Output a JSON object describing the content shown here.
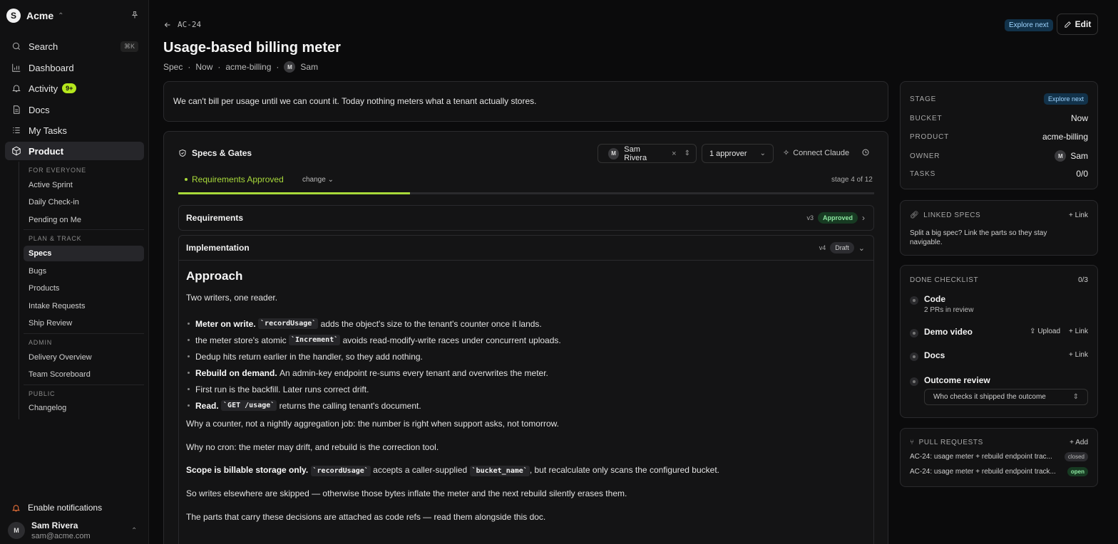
{
  "workspace": {
    "initial": "S",
    "name": "Acme"
  },
  "nav": {
    "search": "Search",
    "search_kbd": "⌘K",
    "dashboard": "Dashboard",
    "activity": "Activity",
    "activity_badge": "9+",
    "docs": "Docs",
    "my_tasks": "My Tasks",
    "product": "Product"
  },
  "sections": {
    "everyone": "FOR EVERYONE",
    "plan": "PLAN & TRACK",
    "admin": "ADMIN",
    "public": "PUBLIC"
  },
  "subnav": {
    "active_sprint": "Active Sprint",
    "daily_checkin": "Daily Check-in",
    "pending": "Pending on Me",
    "specs": "Specs",
    "bugs": "Bugs",
    "products": "Products",
    "intake": "Intake Requests",
    "ship_review": "Ship Review",
    "delivery": "Delivery Overview",
    "scoreboard": "Team Scoreboard",
    "changelog": "Changelog"
  },
  "footer": {
    "notifications": "Enable notifications",
    "user_initial": "M",
    "user_name": "Sam Rivera",
    "user_email": "sam@acme.com"
  },
  "header": {
    "breadcrumb": "AC-24",
    "status_badge": "Explore next",
    "edit": "Edit",
    "title": "Usage-based billing meter",
    "meta": {
      "type": "Spec",
      "sep": "·",
      "bucket": "Now",
      "product": "acme-billing",
      "owner_initial": "M",
      "owner": "Sam"
    }
  },
  "summary": "We can't bill per usage until we can count it. Today nothing meters what a tenant actually stores.",
  "gates": {
    "title": "Specs & Gates",
    "owner_initial": "M",
    "owner_select": "Sam Rivera",
    "approvers": "1 approver",
    "connect": "Connect Claude",
    "stage_label": "Requirements Approved",
    "change": "change",
    "stage_count": "stage 4 of 12",
    "progress_fraction": 0.333
  },
  "requirements": {
    "label": "Requirements",
    "version": "v3",
    "status": "Approved"
  },
  "implementation": {
    "label": "Implementation",
    "version": "v4",
    "status": "Draft"
  },
  "doc": {
    "heading": "Approach",
    "intro": "Two writers, one reader.",
    "b1_bold": "Meter on write.",
    "b1_code": "`recordUsage`",
    "b1_text": "adds the object's size to the tenant's counter once it lands.",
    "b2_text1": "the meter store's atomic",
    "b2_code": "`Increment`",
    "b2_text2": "avoids read-modify-write races under concurrent uploads.",
    "b3_text": "Dedup hits return earlier in the handler, so they add nothing.",
    "b4_bold": "Rebuild on demand.",
    "b4_text": "An admin-key endpoint re-sums every tenant and overwrites the meter.",
    "b5_text": "First run is the backfill. Later runs correct drift.",
    "b6_bold": "Read.",
    "b6_code": "`GET /usage`",
    "b6_text": "returns the calling tenant's document.",
    "p1": "Why a counter, not a nightly aggregation job: the number is right when support asks, not tomorrow.",
    "p2": "Why no cron: the meter may drift, and rebuild is the correction tool.",
    "p3_bold": "Scope is billable storage only.",
    "p3_code1": "`recordUsage`",
    "p3_text1": "accepts a caller-supplied",
    "p3_code2": "`bucket_name`",
    "p3_text2": ", but recalculate only scans the configured bucket.",
    "p4": "So writes elsewhere are skipped — otherwise those bytes inflate the meter and the next rebuild silently erases them.",
    "p5": "The parts that carry these decisions are attached as code refs — read them alongside this doc."
  },
  "details": {
    "stage_k": "STAGE",
    "stage_v": "Explore next",
    "bucket_k": "BUCKET",
    "bucket_v": "Now",
    "product_k": "PRODUCT",
    "product_v": "acme-billing",
    "owner_k": "OWNER",
    "owner_initial": "M",
    "owner_v": "Sam",
    "tasks_k": "TASKS",
    "tasks_v": "0/0"
  },
  "linked": {
    "title": "LINKED SPECS",
    "action": "+ Link",
    "text": "Split a big spec? Link the parts so they stay navigable."
  },
  "checklist": {
    "title": "DONE CHECKLIST",
    "count": "0/3",
    "code": "Code",
    "code_sub": "2 PRs in review",
    "demo": "Demo video",
    "upload": "Upload",
    "link": "+ Link",
    "docs": "Docs",
    "docs_link": "+ Link",
    "outcome": "Outcome review",
    "reviewer_placeholder": "Who checks it shipped the outcome"
  },
  "prs": {
    "title": "PULL REQUESTS",
    "add": "+ Add",
    "items": [
      {
        "title": "AC-24: usage meter + rebuild endpoint trac...",
        "state": "closed"
      },
      {
        "title": "AC-24: usage meter + rebuild endpoint track...",
        "state": "open"
      }
    ]
  }
}
